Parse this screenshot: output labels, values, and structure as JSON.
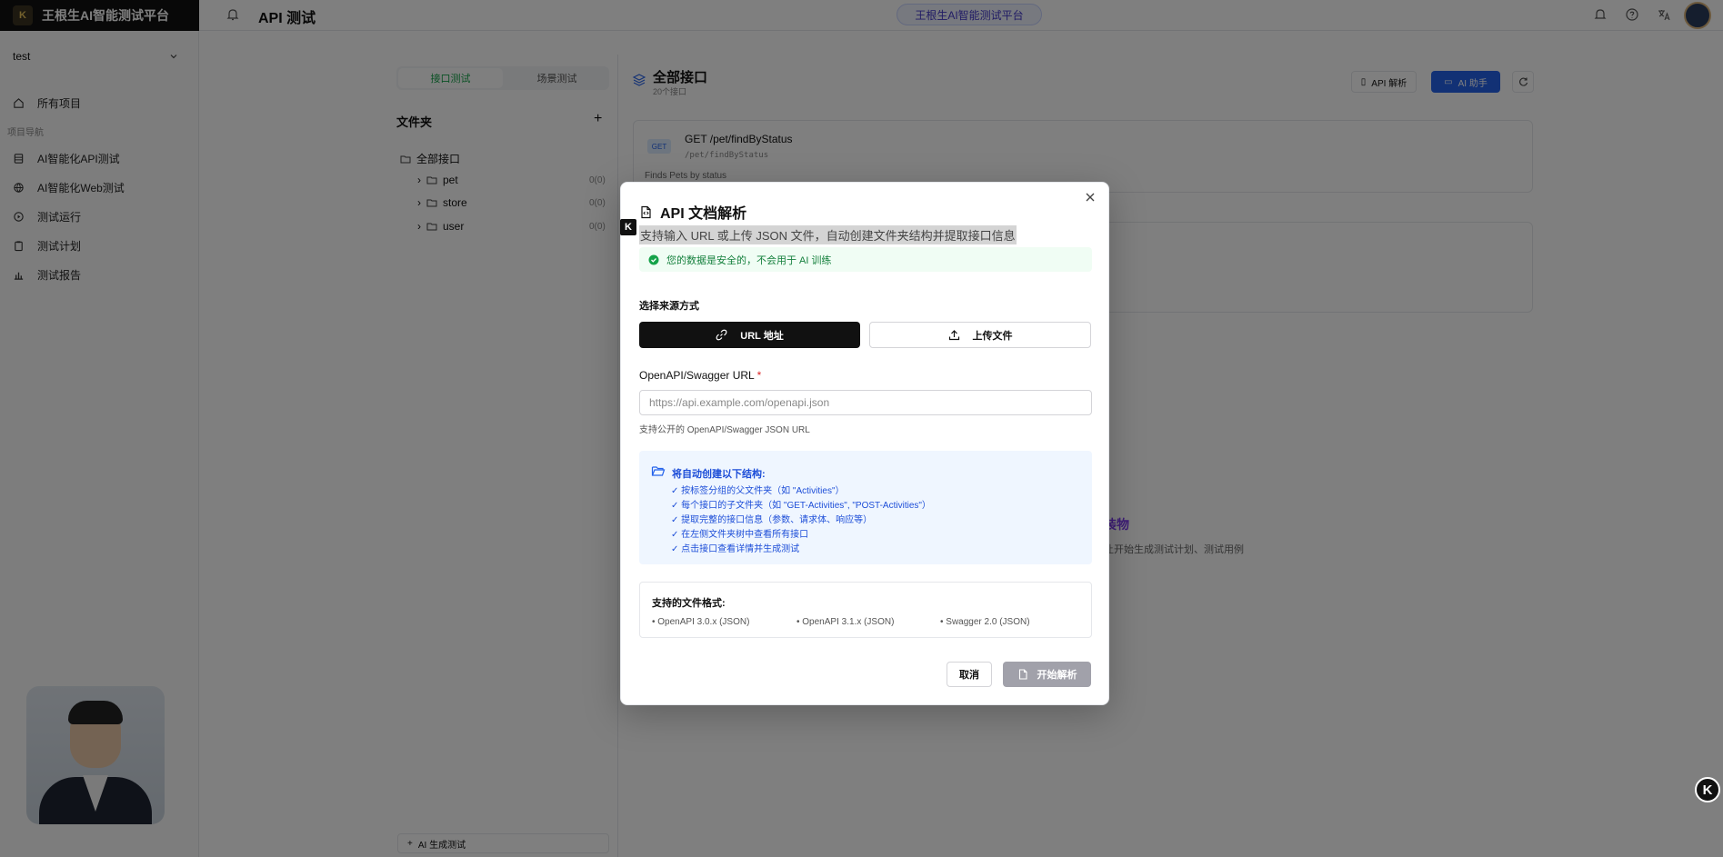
{
  "app": {
    "brand": "王根生AI智能测试平台",
    "brand_logo": "K",
    "page_title": "API 测试",
    "platform_pill": "王根生AI智能测试平台"
  },
  "sidebar": {
    "project": "test",
    "section_label": "项目导航",
    "items": [
      {
        "label": "所有项目",
        "icon": "home-icon"
      },
      {
        "label": "AI智能化API测试",
        "icon": "database-icon"
      },
      {
        "label": "AI智能化Web测试",
        "icon": "globe-icon"
      },
      {
        "label": "测试运行",
        "icon": "play-circle-icon"
      },
      {
        "label": "测试计划",
        "icon": "clipboard-icon"
      },
      {
        "label": "测试报告",
        "icon": "bar-chart-icon"
      }
    ]
  },
  "folder_panel": {
    "tabs": [
      {
        "label": "接口测试"
      },
      {
        "label": "场景测试"
      }
    ],
    "title": "文件夹",
    "add": "+",
    "tree": [
      {
        "label": "全部接口",
        "count": ""
      },
      {
        "label": "pet",
        "count": "0(0)"
      },
      {
        "label": "store",
        "count": "0(0)"
      },
      {
        "label": "user",
        "count": "0(0)"
      }
    ],
    "ai_generate": "AI 生成测试"
  },
  "main": {
    "title": "全部接口",
    "subtitle": "20个接口",
    "api_parse_label": "API 解析",
    "ai_assist_label": "AI 助手",
    "card": {
      "method": "GET",
      "endpoint": "GET /pet/findByStatus",
      "path": "/pet/findByStatus",
      "desc": "Finds Pets by status"
    },
    "empty_title": "装物",
    "empty_sub": "让开始生成测试计划、测试用例"
  },
  "floater_label": "K",
  "dialog": {
    "title": "API 文档解析",
    "marker": "K",
    "description": "支持输入 URL 或上传 JSON 文件，自动创建文件夹结构并提取接口信息",
    "safe_notice": "您的数据是安全的，不会用于 AI 训练",
    "source_label": "选择来源方式",
    "btn_url": "URL 地址",
    "btn_upload": "上传文件",
    "url_label": "OpenAPI/Swagger URL",
    "url_required": "*",
    "url_placeholder": "https://api.example.com/openapi.json",
    "url_value": "",
    "url_hint": "支持公开的 OpenAPI/Swagger JSON URL",
    "structure_title": "将自动创建以下结构:",
    "structure_items": [
      "✓ 按标签分组的父文件夹（如 \"Activities\"）",
      "✓ 每个接口的子文件夹（如 \"GET-Activities\", \"POST-Activities\"）",
      "✓ 提取完整的接口信息（参数、请求体、响应等）",
      "✓ 在左侧文件夹树中查看所有接口",
      "✓ 点击接口查看详情并生成测试"
    ],
    "formats_title": "支持的文件格式:",
    "formats": [
      "• OpenAPI 3.0.x (JSON)",
      "• OpenAPI 3.1.x (JSON)",
      "• Swagger 2.0 (JSON)"
    ],
    "cancel": "取消",
    "start": "开始解析"
  },
  "colors": {
    "accent": "#2563eb",
    "success": "#15803d",
    "primary_button": "#111111",
    "disabled_button": "#a1a1aa",
    "overlay": "rgba(0,0,0,0.5)"
  }
}
